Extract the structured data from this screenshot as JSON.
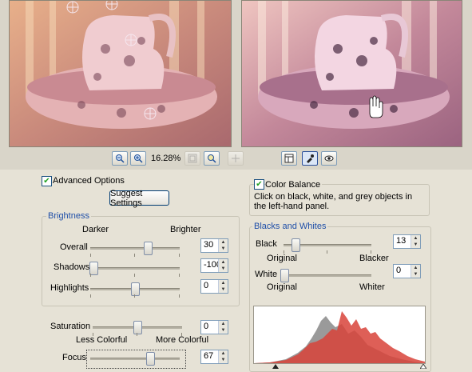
{
  "toolbar": {
    "zoom_level": "16.28%",
    "zoom_out_icon": "zoom-out-icon",
    "zoom_in_icon": "zoom-in-icon",
    "fit_icon": "fit-window-icon",
    "actual_size_icon": "actual-size-icon",
    "pan_icon": "pan-icon",
    "split_view_icon": "split-view-icon",
    "black_eyedropper_icon": "eyedropper-icon",
    "preview_icon": "eye-icon"
  },
  "left_panel": {
    "advanced_options": {
      "label": "Advanced Options",
      "checked": true
    },
    "suggest_button": "Suggest Settings",
    "brightness": {
      "title": "Brightness",
      "darker": "Darker",
      "brighter": "Brighter",
      "overall": {
        "label": "Overall",
        "value": "30"
      },
      "shadows": {
        "label": "Shadows",
        "value": "-100"
      },
      "highlights": {
        "label": "Highlights",
        "value": "0"
      }
    },
    "saturation": {
      "label": "Saturation",
      "value": "0",
      "less": "Less Colorful",
      "more": "More Colorful"
    },
    "focus": {
      "label": "Focus",
      "value": "67"
    }
  },
  "right_panel": {
    "color_balance": {
      "label": "Color Balance",
      "checked": true,
      "hint": "Click on black, white, and grey objects in the left-hand panel."
    },
    "blacks_whites": {
      "title": "Blacks and Whites",
      "black": {
        "label": "Black",
        "value": "13",
        "min_label": "Original",
        "max_label": "Blacker"
      },
      "white": {
        "label": "White",
        "value": "0",
        "min_label": "Original",
        "max_label": "Whiter"
      }
    }
  },
  "colors": {
    "accent_title": "#1f4fa8",
    "histogram_red": "#d8433a",
    "histogram_grey": "#9a9a9a"
  }
}
